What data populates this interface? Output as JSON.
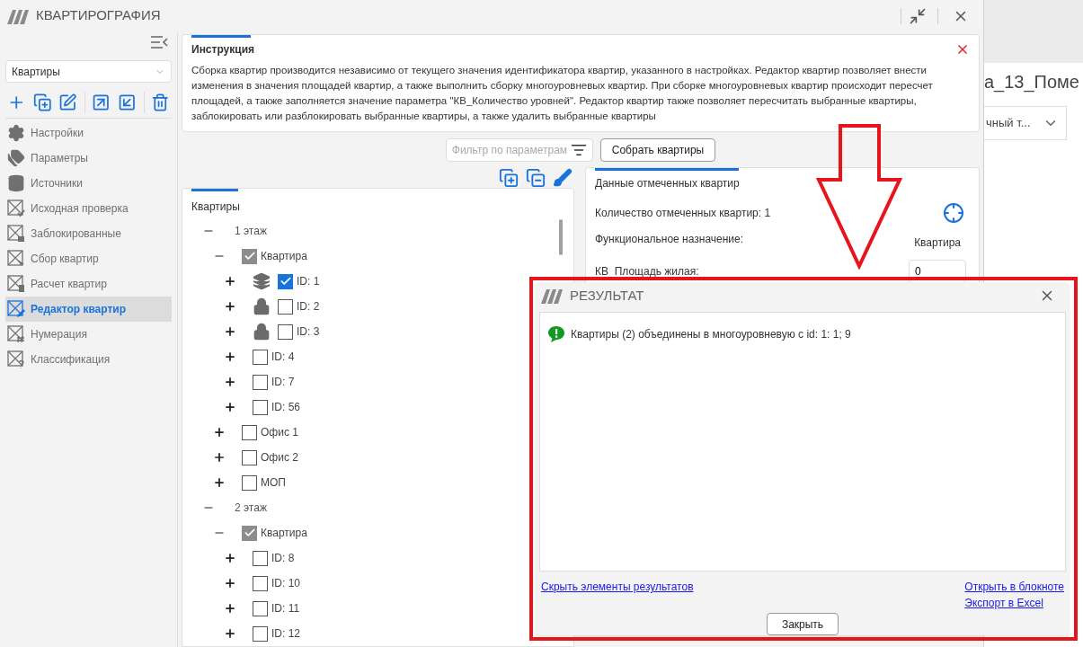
{
  "window": {
    "title": "КВАРТИРОГРАФИЯ"
  },
  "sidebar": {
    "select": {
      "value": "Квартиры"
    },
    "items": [
      {
        "label": "Настройки",
        "selected": false
      },
      {
        "label": "Параметры",
        "selected": false
      },
      {
        "label": "Источники",
        "selected": false
      },
      {
        "label": "Исходная проверка",
        "selected": false
      },
      {
        "label": "Заблокированные",
        "selected": false
      },
      {
        "label": "Сбор квартир",
        "selected": false
      },
      {
        "label": "Расчет квартир",
        "selected": false
      },
      {
        "label": "Редактор квартир",
        "selected": true
      },
      {
        "label": "Нумерация",
        "selected": false
      },
      {
        "label": "Классификация",
        "selected": false
      }
    ]
  },
  "instruction": {
    "title": "Инструкция",
    "text": "Сборка квартир производится независимо от текущего значения идентификатора квартир, указанного в настройках. Редактор квартир позволяет внести изменения в значения площадей квартир, а также выполнить сборку многоуровневых квартир. При сборке многоуровневых квартир происходит пересчет площадей, а также заполняется значение параметра \"КВ_Количество уровней\". Редактор квартир также позволяет пересчитать выбранные квартиры, заблокировать или разблокировать выбранные квартиры, а также удалить выбранные квартиры"
  },
  "filter": {
    "placeholder": "Фильтр по параметрам"
  },
  "assemble_button": "Собрать квартиры",
  "tree": {
    "title": "Квартиры",
    "nodes": [
      {
        "label": "1 этаж",
        "expanded": true,
        "children": [
          {
            "label": "Квартира",
            "expanded": true,
            "checked": true,
            "children": [
              {
                "label": "ID: 1",
                "expanded": false,
                "checked": true,
                "kind": "multilevel"
              },
              {
                "label": "ID: 2",
                "expanded": false,
                "checked": false,
                "kind": "locked"
              },
              {
                "label": "ID: 3",
                "expanded": false,
                "checked": false,
                "kind": "locked"
              },
              {
                "label": "ID: 4",
                "expanded": false,
                "checked": false,
                "kind": "plain"
              },
              {
                "label": "ID: 7",
                "expanded": false,
                "checked": false,
                "kind": "plain"
              },
              {
                "label": "ID: 56",
                "expanded": false,
                "checked": false,
                "kind": "plain"
              }
            ]
          },
          {
            "label": "Офис 1",
            "expanded": false,
            "checked": false
          },
          {
            "label": "Офис 2",
            "expanded": false,
            "checked": false
          },
          {
            "label": "МОП",
            "expanded": false,
            "checked": false
          }
        ]
      },
      {
        "label": "2 этаж",
        "expanded": true,
        "children": [
          {
            "label": "Квартира",
            "expanded": true,
            "checked": true,
            "children": [
              {
                "label": "ID: 8",
                "expanded": false,
                "checked": false,
                "kind": "plain"
              },
              {
                "label": "ID: 10",
                "expanded": false,
                "checked": false,
                "kind": "plain"
              },
              {
                "label": "ID: 11",
                "expanded": false,
                "checked": false,
                "kind": "plain"
              },
              {
                "label": "ID: 12",
                "expanded": false,
                "checked": false,
                "kind": "plain"
              }
            ]
          }
        ]
      }
    ]
  },
  "details": {
    "title": "Данные отмеченных квартир",
    "count": "Количество отмеченных квартир: 1",
    "function_label": "Функциональное назначение:",
    "function_value": "Квартира",
    "area_label": "КВ_Площадь жилая:",
    "area_value": "0"
  },
  "background_window": {
    "title": "а_13_Поме",
    "dropdown": "чный т..."
  },
  "dialog": {
    "title": "РЕЗУЛЬТАТ",
    "message": "Квартиры (2) объединены в многоуровневую с id: 1: 1; 9",
    "hide_link": "Скрыть элементы результатов",
    "notepad_link": "Открыть в блокноте",
    "excel_link": "Экспорт в Excel",
    "close_button": "Закрыть"
  }
}
